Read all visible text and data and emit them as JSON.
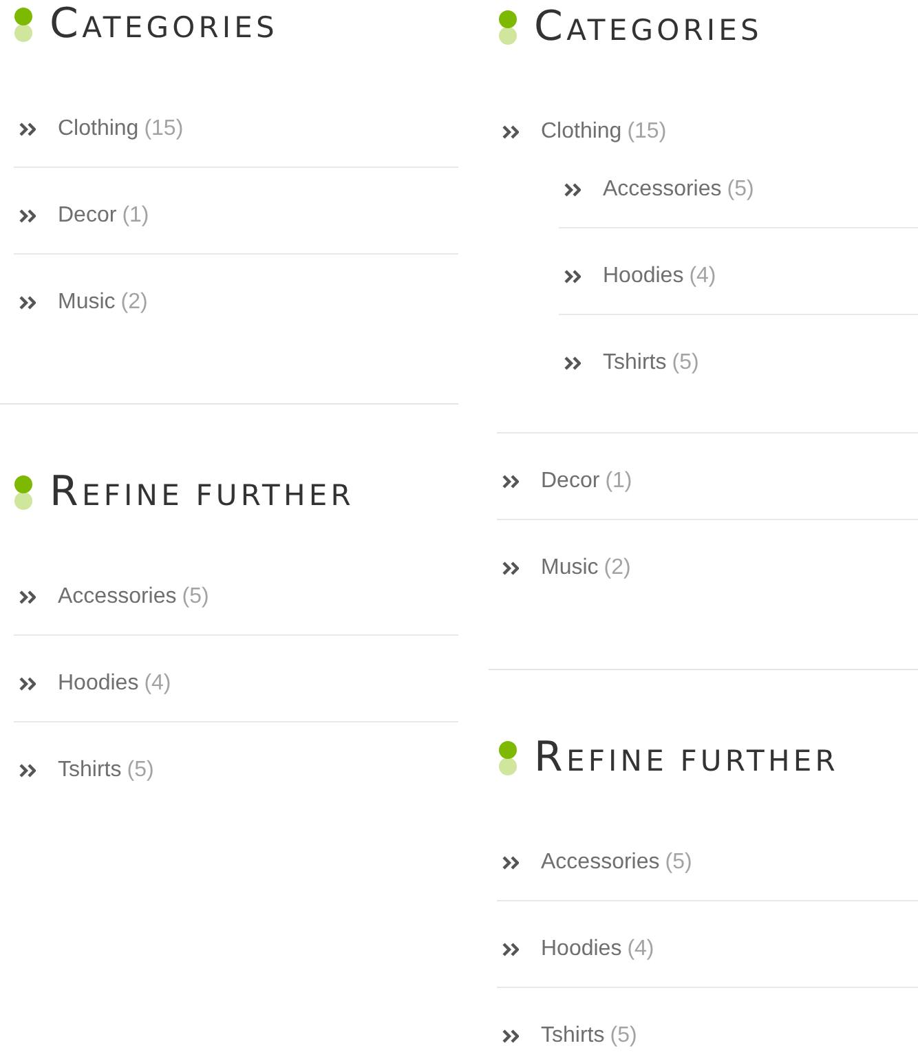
{
  "columns": [
    {
      "sections": [
        {
          "title": "CATEGORIES",
          "items": [
            {
              "label": "Clothing",
              "count": "(15)"
            },
            {
              "label": "Decor",
              "count": "(1)"
            },
            {
              "label": "Music",
              "count": "(2)"
            }
          ]
        },
        {
          "title": "REFINE FURTHER",
          "items": [
            {
              "label": "Accessories",
              "count": "(5)"
            },
            {
              "label": "Hoodies",
              "count": "(4)"
            },
            {
              "label": "Tshirts",
              "count": "(5)"
            }
          ]
        }
      ]
    },
    {
      "sections": [
        {
          "title": "CATEGORIES",
          "items": [
            {
              "label": "Clothing",
              "count": "(15)",
              "children": [
                {
                  "label": "Accessories",
                  "count": "(5)"
                },
                {
                  "label": "Hoodies",
                  "count": "(4)"
                },
                {
                  "label": "Tshirts",
                  "count": "(5)"
                }
              ]
            },
            {
              "label": "Decor",
              "count": "(1)"
            },
            {
              "label": "Music",
              "count": "(2)"
            }
          ]
        },
        {
          "title": "REFINE FURTHER",
          "items": [
            {
              "label": "Accessories",
              "count": "(5)"
            },
            {
              "label": "Hoodies",
              "count": "(4)"
            },
            {
              "label": "Tshirts",
              "count": "(5)"
            }
          ]
        }
      ]
    }
  ]
}
